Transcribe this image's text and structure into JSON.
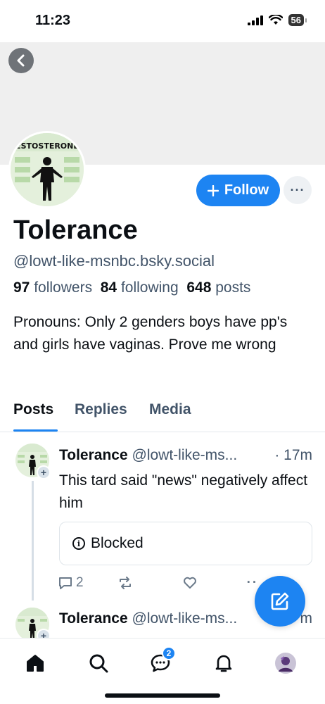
{
  "status_bar": {
    "time": "11:23",
    "battery": "56"
  },
  "profile": {
    "follow_label": "Follow",
    "more_label": "···",
    "display_name": "Tolerance",
    "handle": "@lowt-like-msnbc.bsky.social",
    "followers_count": "97",
    "followers_label": "followers",
    "following_count": "84",
    "following_label": "following",
    "posts_count": "648",
    "posts_label": "posts",
    "bio": "Pronouns: Only 2 genders boys have pp's and girls have vaginas. Prove me wrong",
    "avatar_text": "ESTOSTERONE"
  },
  "tabs": [
    {
      "label": "Posts",
      "active": true
    },
    {
      "label": "Replies",
      "active": false
    },
    {
      "label": "Media",
      "active": false
    }
  ],
  "posts": [
    {
      "author": "Tolerance",
      "handle": "@lowt-like-ms...",
      "time": "· 17m",
      "text": "This tard said \"news\" negatively affect him",
      "embed": "Blocked",
      "reply_count": "2"
    },
    {
      "author": "Tolerance",
      "handle": "@lowt-like-ms...",
      "time": "m"
    }
  ],
  "nav": {
    "messages_badge": "2"
  },
  "colors": {
    "accent": "#1d84f2",
    "muted": "#425469",
    "text": "#0b0f14"
  }
}
